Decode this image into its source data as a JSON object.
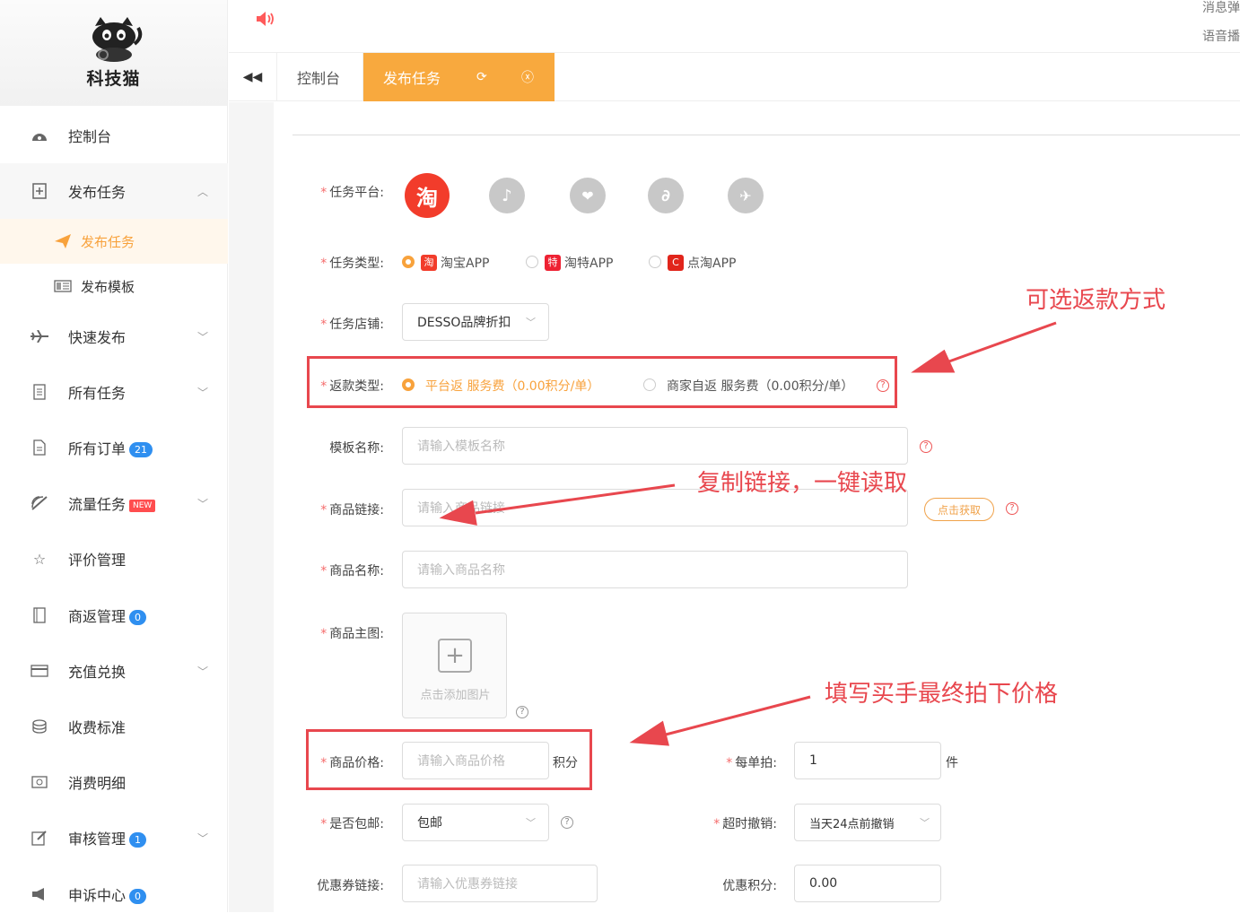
{
  "brand": {
    "name": "科技猫"
  },
  "topbar": {
    "msg_popup": "消息弹",
    "voice": "语音播"
  },
  "tabs": {
    "home": "控制台",
    "active": "发布任务"
  },
  "sidebar": {
    "items": [
      {
        "label": "控制台",
        "icon": "dashboard-icon"
      },
      {
        "label": "发布任务",
        "icon": "publish-icon",
        "expanded": true
      },
      {
        "label": "快速发布",
        "icon": "plane-icon"
      },
      {
        "label": "所有任务",
        "icon": "list-icon"
      },
      {
        "label": "所有订单",
        "icon": "order-icon",
        "badge": "21"
      },
      {
        "label": "流量任务",
        "icon": "traffic-icon",
        "tag": "NEW"
      },
      {
        "label": "评价管理",
        "icon": "star-icon"
      },
      {
        "label": "商返管理",
        "icon": "book-icon",
        "badge": "0"
      },
      {
        "label": "充值兑换",
        "icon": "card-icon"
      },
      {
        "label": "收费标准",
        "icon": "coins-icon"
      },
      {
        "label": "消费明细",
        "icon": "receipt-icon"
      },
      {
        "label": "审核管理",
        "icon": "edit-icon",
        "badge": "1"
      },
      {
        "label": "申诉中心",
        "icon": "megaphone-icon",
        "badge": "0"
      }
    ],
    "sub_items": [
      {
        "label": "发布任务",
        "active": true
      },
      {
        "label": "发布模板"
      }
    ]
  },
  "form": {
    "platform_label": "任务平台:",
    "platforms": [
      "淘宝",
      "抖音",
      "拼多多",
      "阿里",
      "其他"
    ],
    "type_label": "任务类型:",
    "types": [
      "淘宝APP",
      "淘特APP",
      "点淘APP"
    ],
    "shop_label": "任务店铺:",
    "shop_value": "DESSO品牌折扣",
    "refund_label": "返款类型:",
    "refund_options": [
      "平台返 服务费（0.00积分/单）",
      "商家自返 服务费（0.00积分/单）"
    ],
    "template_label": "模板名称:",
    "template_placeholder": "请输入模板名称",
    "link_label": "商品链接:",
    "link_placeholder": "请输入商品链接",
    "fetch_btn": "点击获取",
    "name_label": "商品名称:",
    "name_placeholder": "请输入商品名称",
    "image_label": "商品主图:",
    "image_add": "点击添加图片",
    "price_label": "商品价格:",
    "price_placeholder": "请输入商品价格",
    "price_unit": "积分",
    "per_order_label": "每单拍:",
    "per_order_value": "1",
    "per_order_unit": "件",
    "shipping_label": "是否包邮:",
    "shipping_value": "包邮",
    "timeout_label": "超时撤销:",
    "timeout_value": "当天24点前撤销",
    "coupon_label": "优惠券链接:",
    "coupon_placeholder": "请输入优惠券链接",
    "discount_label": "优惠积分:",
    "discount_value": "0.00"
  },
  "annotations": {
    "refund": "可选返款方式",
    "link": "复制链接，一键读取",
    "price": "填写买手最终拍下价格"
  },
  "colors": {
    "accent": "#f8a93e",
    "annotation": "#e8474e",
    "badge": "#2f8ff0"
  }
}
